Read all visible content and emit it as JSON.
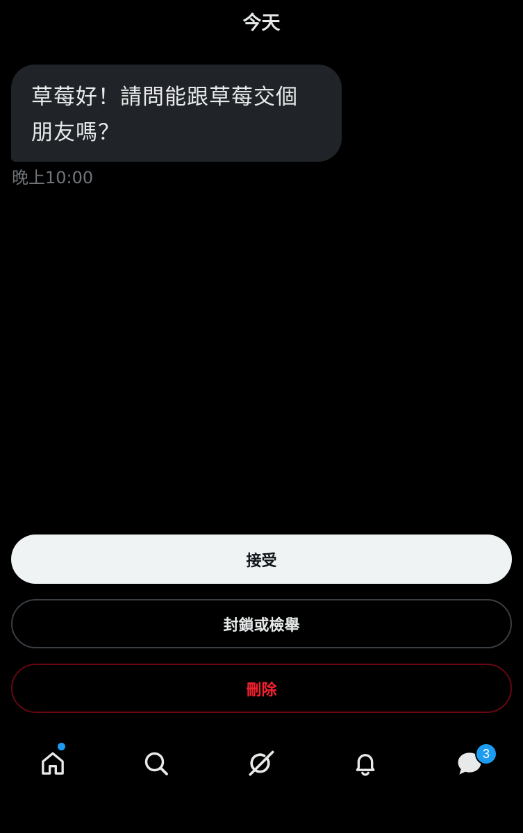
{
  "header": {
    "date_label": "今天"
  },
  "conversation": {
    "messages": [
      {
        "text_line1": "草莓好！請問能跟草莓交個",
        "text_line2": "朋友嗎？",
        "time": "晚上10:00"
      }
    ]
  },
  "actions": {
    "accept_label": "接受",
    "block_report_label": "封鎖或檢舉",
    "delete_label": "刪除"
  },
  "bottom_nav": {
    "items": [
      {
        "icon": "home-icon",
        "has_dot": true
      },
      {
        "icon": "search-icon"
      },
      {
        "icon": "grok-icon"
      },
      {
        "icon": "bell-icon"
      },
      {
        "icon": "messages-icon",
        "badge_count": "3"
      }
    ]
  },
  "colors": {
    "background": "#000000",
    "bubble": "#202327",
    "text_primary": "#e7e9ea",
    "text_secondary": "#71767b",
    "accent_blue": "#1d9bf0",
    "danger_red": "#f4212e",
    "accept_bg": "#eff3f4"
  }
}
